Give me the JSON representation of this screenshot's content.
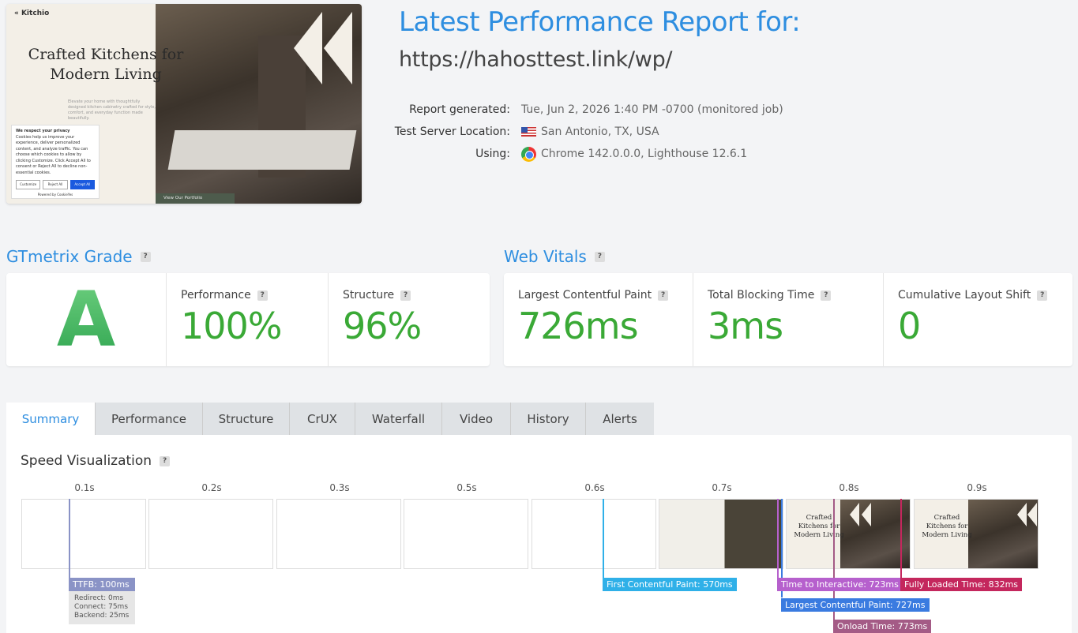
{
  "screenshot": {
    "logo": "Kitchio",
    "hero": "Crafted Kitchens for Modern Living",
    "blurb": "Elevate your home with thoughtfully designed kitchen cabinetry crafted for style, comfort, and everyday function made beautifully.",
    "cookie_title": "We respect your privacy",
    "cookie_text": "Cookies help us improve your experience, deliver personalized content, and analyze traffic. You can choose which cookies to allow by clicking Customize. Click Accept All to consent or Reject All to decline non-essential cookies.",
    "cookie_buttons": [
      "Customize",
      "Reject All",
      "Accept All"
    ],
    "cookie_footer": "Powered by CookieYes",
    "portfolio_link": "View Our Portfolio"
  },
  "header": {
    "title": "Latest Performance Report for:",
    "url": "https://hahosttest.link/wp/",
    "meta": [
      {
        "label": "Report generated:",
        "value": "Tue, Jun 2, 2026 1:40 PM -0700 (monitored job)",
        "icon": ""
      },
      {
        "label": "Test Server Location:",
        "value": "San Antonio, TX, USA",
        "icon": "us-flag-icon"
      },
      {
        "label": "Using:",
        "value": "Chrome 142.0.0.0, Lighthouse 12.6.1",
        "icon": "chrome-icon"
      }
    ]
  },
  "grade": {
    "title": "GTmetrix Grade",
    "help": "?",
    "letter": "A",
    "performance_label": "Performance",
    "performance_value": "100%",
    "structure_label": "Structure",
    "structure_value": "96%"
  },
  "vitals": {
    "title": "Web Vitals",
    "help": "?",
    "items": [
      {
        "label": "Largest Contentful Paint",
        "value": "726ms"
      },
      {
        "label": "Total Blocking Time",
        "value": "3ms"
      },
      {
        "label": "Cumulative Layout Shift",
        "value": "0"
      }
    ]
  },
  "tabs": [
    "Summary",
    "Performance",
    "Structure",
    "CrUX",
    "Waterfall",
    "Video",
    "History",
    "Alerts"
  ],
  "active_tab": "Summary",
  "speed": {
    "title": "Speed Visualization",
    "ticks": [
      "0.1s",
      "0.2s",
      "0.3s",
      "0.5s",
      "0.6s",
      "0.7s",
      "0.8s",
      "0.9s"
    ],
    "markers": {
      "ttfb": "TTFB: 100ms",
      "ttfb_details": [
        "Redirect: 0ms",
        "Connect: 75ms",
        "Backend: 25ms"
      ],
      "fcp": "First Contentful Paint: 570ms",
      "tti": "Time to Interactive: 723ms",
      "lcp": "Largest Contentful Paint: 727ms",
      "onload": "Onload Time: 773ms",
      "fully_loaded": "Fully Loaded Time: 832ms"
    },
    "thumb_hero": "Crafted Kitchens for Modern Living",
    "colors": {
      "ttfb": "#8a93c6",
      "fcp": "#2fb0e8",
      "tti": "#b660cd",
      "lcp": "#3a7be0",
      "onload": "#a45b86",
      "fully_loaded": "#c4275d"
    }
  }
}
